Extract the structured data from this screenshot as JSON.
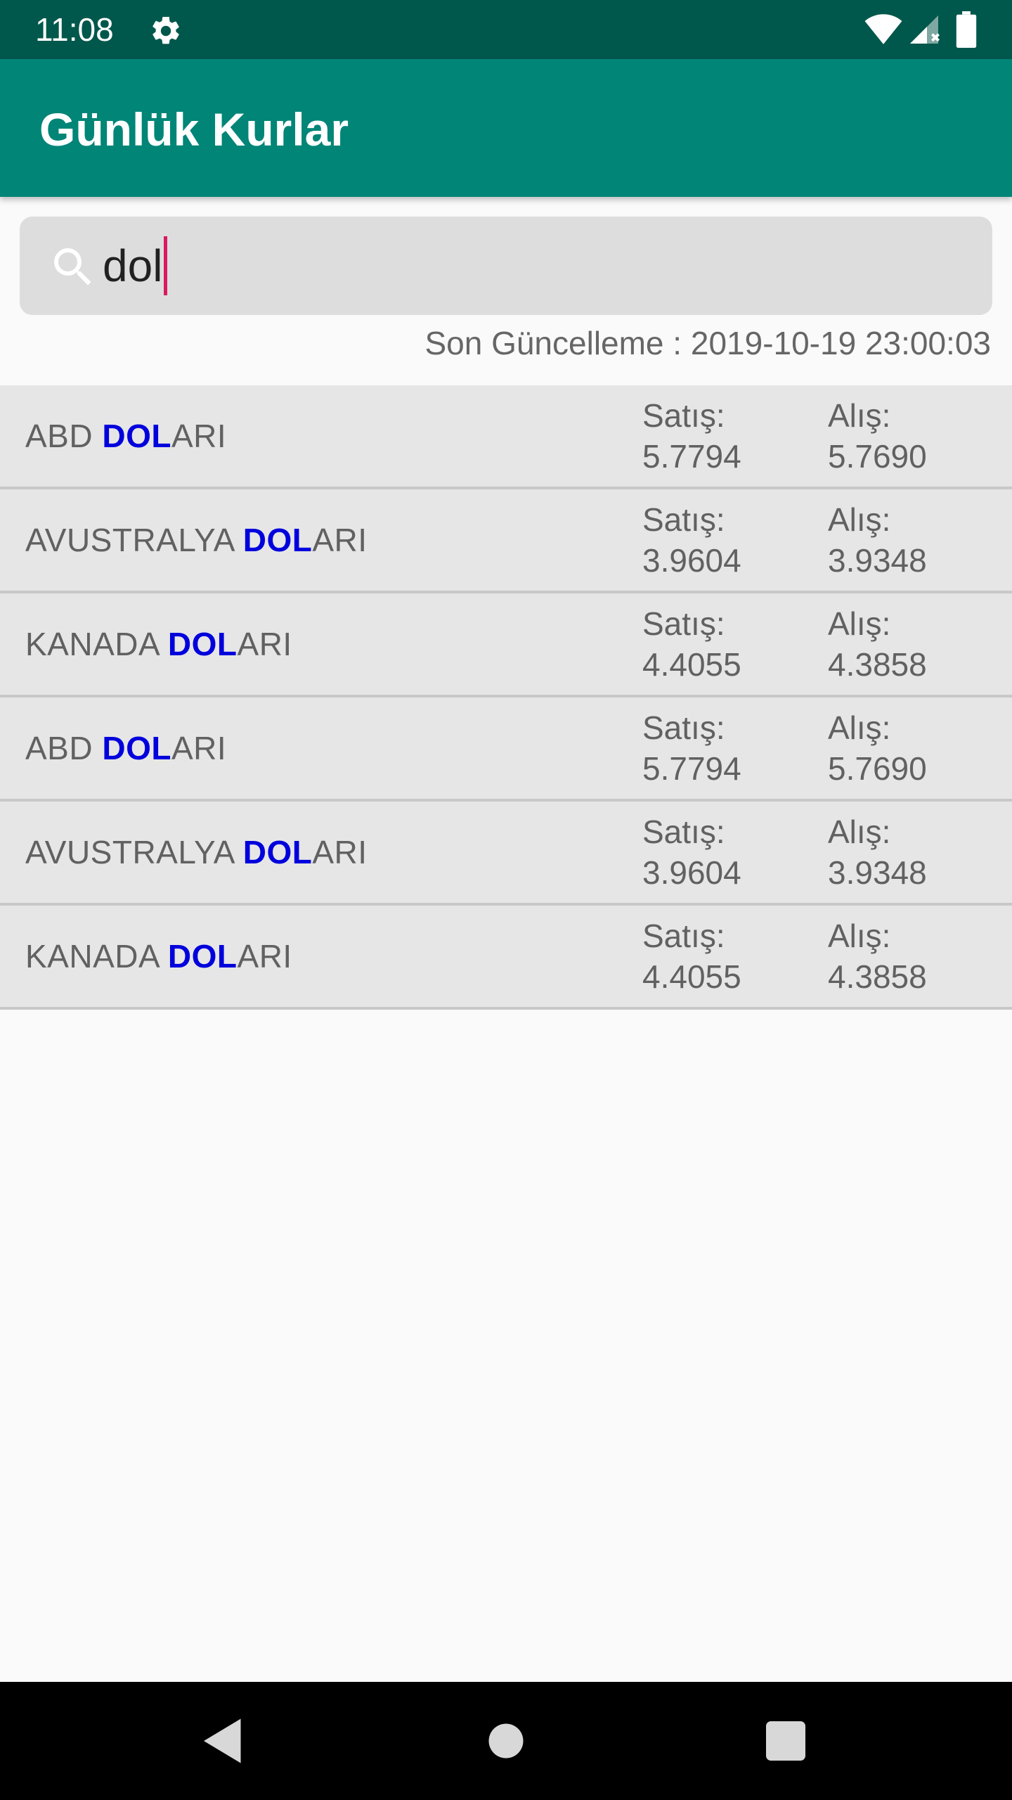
{
  "status_bar": {
    "time": "11:08",
    "icons": [
      "gear-icon",
      "wifi-icon",
      "signal-icon",
      "battery-icon"
    ]
  },
  "app_bar": {
    "title": "Günlük Kurlar",
    "color": "#008577"
  },
  "search": {
    "value": "dol",
    "icon": "search-icon"
  },
  "last_update": "Son Güncelleme : 2019-10-19 23:00:03",
  "rates": [
    {
      "name_pre": "ABD ",
      "name_match": "DOL",
      "name_post": "ARI",
      "sell_label": "Satış:",
      "sell": "5.7794",
      "buy_label": "Alış:",
      "buy": "5.7690"
    },
    {
      "name_pre": "AVUSTRALYA ",
      "name_match": "DOL",
      "name_post": "ARI",
      "sell_label": "Satış:",
      "sell": "3.9604",
      "buy_label": "Alış:",
      "buy": "3.9348"
    },
    {
      "name_pre": "KANADA ",
      "name_match": "DOL",
      "name_post": "ARI",
      "sell_label": "Satış:",
      "sell": "4.4055",
      "buy_label": "Alış:",
      "buy": "4.3858"
    },
    {
      "name_pre": "ABD ",
      "name_match": "DOL",
      "name_post": "ARI",
      "sell_label": "Satış:",
      "sell": "5.7794",
      "buy_label": "Alış:",
      "buy": "5.7690"
    },
    {
      "name_pre": "AVUSTRALYA ",
      "name_match": "DOL",
      "name_post": "ARI",
      "sell_label": "Satış:",
      "sell": "3.9604",
      "buy_label": "Alış:",
      "buy": "3.9348"
    },
    {
      "name_pre": "KANADA ",
      "name_match": "DOL",
      "name_post": "ARI",
      "sell_label": "Satış:",
      "sell": "4.4055",
      "buy_label": "Alış:",
      "buy": "4.3858"
    }
  ],
  "highlight_color": "#0000dd",
  "nav": {
    "icons": [
      "back-icon",
      "home-icon",
      "recents-icon"
    ]
  }
}
